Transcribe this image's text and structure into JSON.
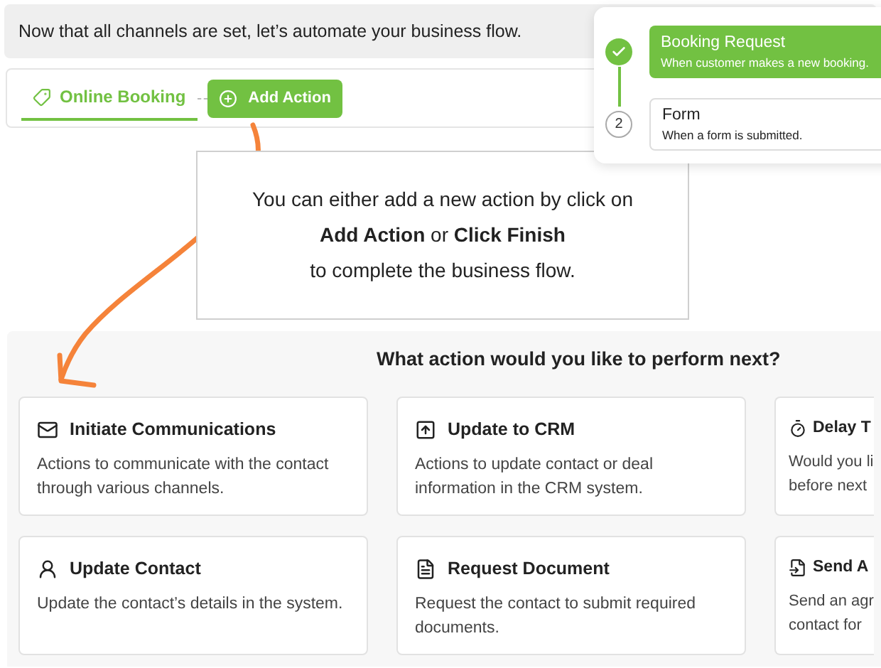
{
  "banner": {
    "text": "Now that all channels are set, let’s automate your business flow."
  },
  "flow": {
    "trigger": {
      "label": "Online Booking",
      "selected": true
    },
    "add_button": {
      "label": "Add Action"
    }
  },
  "steps": [
    {
      "completed": true,
      "title": "Booking Request",
      "subtitle": "When customer makes a new booking."
    },
    {
      "marker": "2",
      "completed": false,
      "title": "Form",
      "subtitle": "When a form is submitted."
    }
  ],
  "tooltip": {
    "line_1": "You can either add a new action by click on",
    "line_2": "**Add Action** or **Click Finish**",
    "line_3": "to complete the business flow."
  },
  "actions_panel": {
    "title": "What action would you like to perform next?",
    "cards": [
      {
        "kind": "mail",
        "title": "Initiate Communications",
        "description": "Actions to communicate with the contact through various channels."
      },
      {
        "kind": "crm",
        "title": "Update to CRM",
        "description": "Actions to update contact or deal information in the CRM system."
      },
      {
        "kind": "timer",
        "title": "Delay T",
        "description_lines": [
          "Would you li",
          "before next"
        ]
      },
      {
        "kind": "contact",
        "title": "Update Contact",
        "description": "Update the contact’s details in the system."
      },
      {
        "kind": "document",
        "title": "Request Document",
        "description": "Request the contact to submit required documents."
      },
      {
        "kind": "send",
        "title": "Send A",
        "description_lines": [
          "Send an agr",
          "contact for"
        ]
      }
    ]
  }
}
